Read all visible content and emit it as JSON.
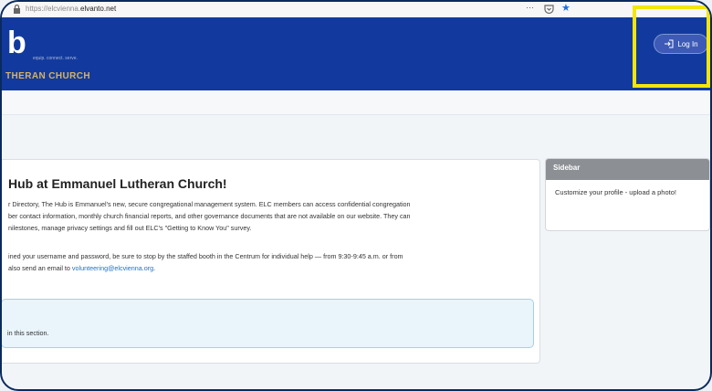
{
  "browser": {
    "url_prefix": "https://elcvienna.",
    "url_domain": "elvanto.net",
    "more_menu": "···"
  },
  "header": {
    "logo_letter": "b",
    "tagline": "equip. connect. serve.",
    "church_name": "THERAN CHURCH",
    "login_label": "Log In"
  },
  "main": {
    "heading": "Hub at Emmanuel Lutheran Church!",
    "paragraph1": [
      "r Directory, The Hub is Emmanuel's new, secure congregational management system. ELC members can access confidential congregation",
      "ber contact information, monthly church financial reports, and other governance documents that are not available on our website.  They can",
      "nilestones, manage privacy settings and fill out ELC's \"Getting to Know You\" survey."
    ],
    "paragraph2_line1": "ined your username and password, be sure to stop by the staffed booth in the Centrum for individual help — from 9:30-9:45 a.m. or from",
    "paragraph2_line2_prefix": " also send an email to ",
    "email": "volunteering@elcvienna.org",
    "paragraph2_line2_suffix": ".",
    "notice_text": "in this section."
  },
  "sidebar": {
    "title": "Sidebar",
    "text": "Customize your profile - upload a photo!"
  }
}
